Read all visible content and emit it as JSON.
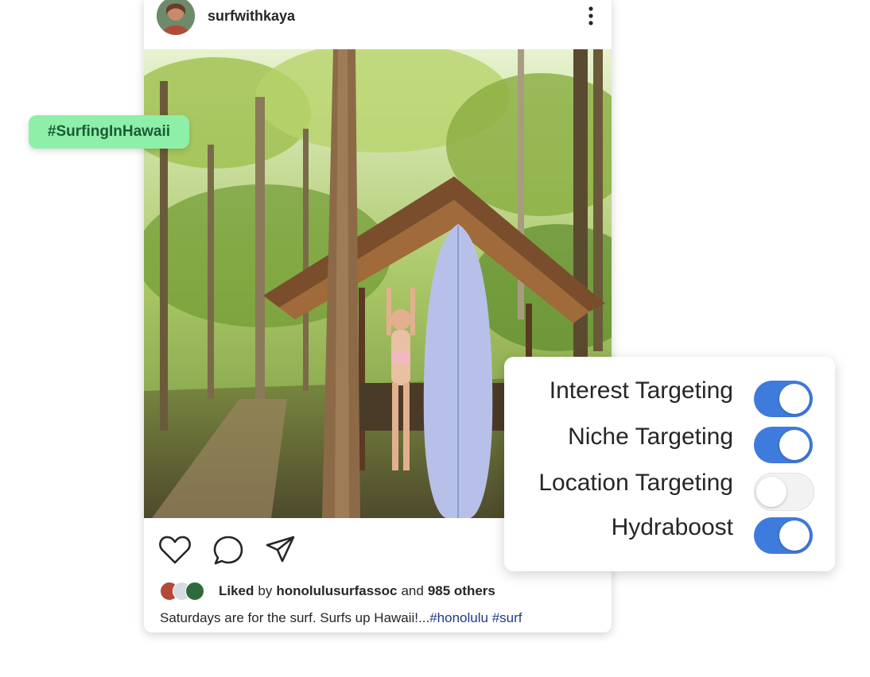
{
  "post": {
    "username": "surfwithkaya",
    "liked_prefix": "Liked",
    "liked_by": "by",
    "liked_user": "honolulusurfassoc",
    "liked_and": "and",
    "liked_others": "985 others",
    "caption_text": "Saturdays are for the surf. Surfs up Hawaii!...",
    "caption_tag1": "#honolulu",
    "caption_tag2": "#surf"
  },
  "hashtag_chip": "#SurfingInHawaii",
  "targeting": [
    {
      "label": "Interest Targeting",
      "enabled": true
    },
    {
      "label": "Niche Targeting",
      "enabled": true
    },
    {
      "label": "Location Targeting",
      "enabled": false
    },
    {
      "label": "Hydraboost",
      "enabled": true
    }
  ],
  "colors": {
    "toggle_on": "#3f7bdc",
    "chip_bg": "#8ef0a8",
    "hashtag_link": "#1f3b8a"
  },
  "icons": [
    "heart-icon",
    "comment-icon",
    "share-icon",
    "more-options-icon"
  ]
}
